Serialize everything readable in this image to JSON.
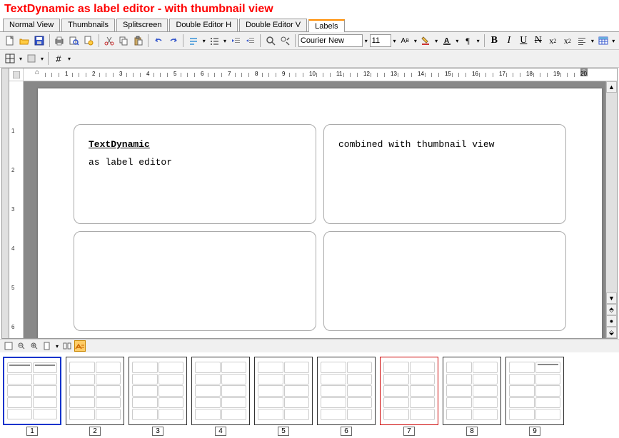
{
  "title": "TextDynamic as label editor - with thumbnail view",
  "tabs": [
    "Normal View",
    "Thumbnails",
    "Splitscreen",
    "Double Editor H",
    "Double Editor V",
    "Labels"
  ],
  "active_tab": 5,
  "font": {
    "name": "Courier New",
    "size": "11"
  },
  "format_buttons": {
    "bold": "B",
    "italic": "I",
    "underline": "U",
    "strike": "N",
    "super": "x²",
    "sub": "x₂"
  },
  "ruler": {
    "h_numbers": [
      1,
      2,
      3,
      4,
      5,
      6,
      7,
      8,
      9,
      10,
      11,
      12,
      13,
      14,
      15,
      16,
      17,
      18,
      19,
      20
    ],
    "v_numbers": [
      1,
      2,
      3,
      4,
      5,
      6
    ]
  },
  "labels": {
    "cell1": {
      "title": "TextDynamic",
      "body": "as label editor"
    },
    "cell2": {
      "body": "combined with thumbnail view"
    }
  },
  "thumbnails": [
    {
      "num": "1",
      "selected": true,
      "has_text": true
    },
    {
      "num": "2"
    },
    {
      "num": "3"
    },
    {
      "num": "4"
    },
    {
      "num": "5"
    },
    {
      "num": "6"
    },
    {
      "num": "7",
      "marked": true
    },
    {
      "num": "8"
    },
    {
      "num": "9",
      "has_text_partial": true
    }
  ],
  "colors": {
    "accent": "#ff8c00",
    "title": "#ff0000",
    "sel": "#0033cc",
    "mark": "#cc0000"
  }
}
